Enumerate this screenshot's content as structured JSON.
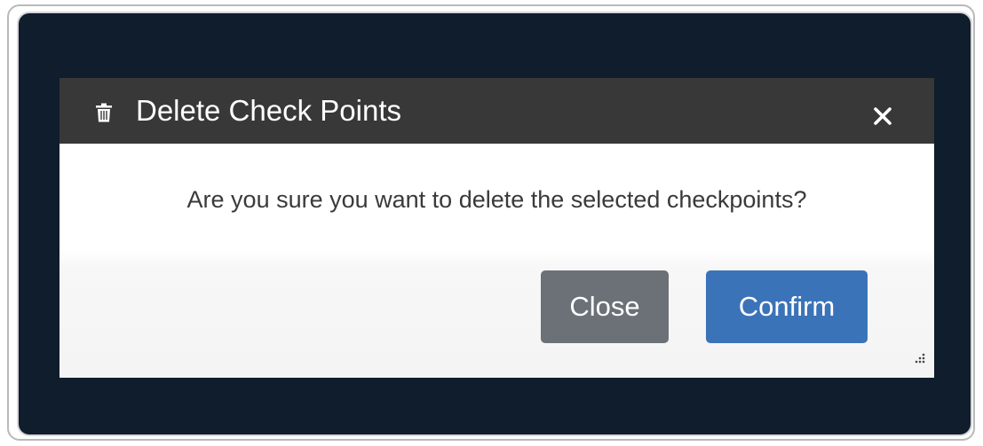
{
  "dialog": {
    "title": "Delete Check Points",
    "title_icon": "trash-icon",
    "close_icon": "close-icon",
    "message": "Are you sure you want to delete the selected checkpoints?",
    "buttons": {
      "close_label": "Close",
      "confirm_label": "Confirm"
    },
    "resize_icon": "resize-grip-icon"
  },
  "colors": {
    "backdrop": "#0f1d2d",
    "header": "#383838",
    "close_button": "#6b7177",
    "confirm_button": "#3b73b9"
  }
}
